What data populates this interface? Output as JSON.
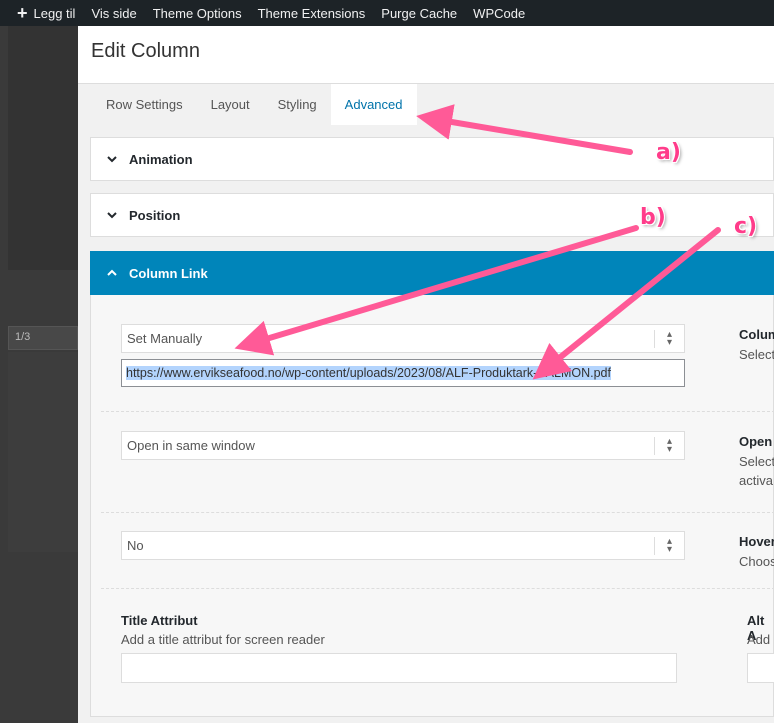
{
  "adminbar": {
    "items": [
      {
        "label": "Legg til",
        "icon": "plus-icon"
      },
      {
        "label": "Vis side"
      },
      {
        "label": "Theme Options"
      },
      {
        "label": "Theme Extensions"
      },
      {
        "label": "Purge Cache"
      },
      {
        "label": "WPCode"
      }
    ]
  },
  "background": {
    "cell_label": "1/3"
  },
  "modal": {
    "title": "Edit Column",
    "tabs": [
      {
        "label": "Row Settings",
        "active": false
      },
      {
        "label": "Layout",
        "active": false
      },
      {
        "label": "Styling",
        "active": false
      },
      {
        "label": "Advanced",
        "active": true
      }
    ],
    "sections": [
      {
        "title": "Animation",
        "open": false
      },
      {
        "title": "Position",
        "open": false
      },
      {
        "title": "Column Link",
        "open": true
      }
    ],
    "column_link": {
      "link_type": {
        "value": "Set Manually",
        "side_label": "Colum",
        "side_desc": "Select"
      },
      "url": {
        "value": "https://www.ervikseafood.no/wp-content/uploads/2023/08/ALF-Produktark-SALMON.pdf"
      },
      "target": {
        "value": "Open in same window",
        "side_label": "Open",
        "side_desc_1": "Select",
        "side_desc_2": "activa"
      },
      "hover": {
        "value": "No",
        "side_label": "Hover",
        "side_desc": "Choos"
      },
      "title_attribute": {
        "label": "Title Attribut",
        "desc": "Add a title attribut for screen reader"
      },
      "alt_attribute": {
        "label": "Alt A",
        "desc": "Add"
      }
    }
  },
  "annotations": {
    "a": "a)",
    "b": "b)",
    "c": "c)"
  },
  "colors": {
    "accent": "#0085ba",
    "annotation": "#ff3c8a",
    "adminbar": "#1d2327"
  }
}
